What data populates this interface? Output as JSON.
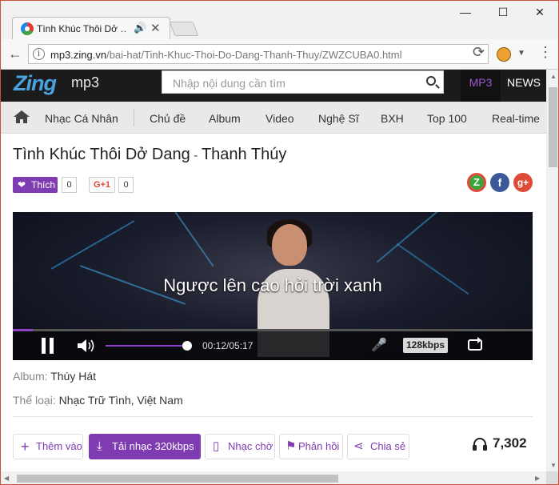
{
  "browser": {
    "tab_title": "Tình Khúc Thôi Dở …",
    "url_host": "mp3.zing.vn",
    "url_path": "/bai-hat/Tinh-Khuc-Thoi-Do-Dang-Thanh-Thuy/ZWZCUBA0.html"
  },
  "header": {
    "logo": "Zing",
    "logo_sub": "mp3",
    "search_placeholder": "Nhập nội dung cần tìm",
    "tab_mp3": "MP3",
    "tab_news": "NEWS"
  },
  "nav": {
    "items": [
      "Nhạc Cá Nhân",
      "Chủ đề",
      "Album",
      "Video",
      "Nghệ Sĩ",
      "BXH",
      "Top 100",
      "Real-time"
    ]
  },
  "song": {
    "title": "Tình Khúc Thôi Dở Dang",
    "dash": " - ",
    "artist": "Thanh Thúy"
  },
  "social": {
    "like_label": "Thích",
    "like_count": "0",
    "gplus_label": "G+1",
    "gplus_count": "0",
    "zing_share": "Z",
    "facebook": "f",
    "google": "g+"
  },
  "player": {
    "lyric": "Ngược lên cao hỏi trời xanh",
    "time": "00:12/05:17",
    "quality": "128kbps",
    "progress": 0.038,
    "volume": 1.0
  },
  "meta": {
    "album_label": "Album:",
    "album_value": "Thúy Hát",
    "genre_label": "Thể loại:",
    "genre_1": "Nhạc Trữ Tình",
    "genre_sep": ", ",
    "genre_2": "Việt Nam"
  },
  "actions": {
    "add": "Thêm vào",
    "download": "Tải nhạc 320kbps",
    "ringtone": "Nhạc chờ",
    "report": "Phản hồi",
    "share": "Chia sẻ",
    "listen_count": "7,302"
  },
  "colors": {
    "accent": "#7e3bb2",
    "header_bg": "#1b1b1b",
    "nav_bg": "#e9e9e9"
  }
}
